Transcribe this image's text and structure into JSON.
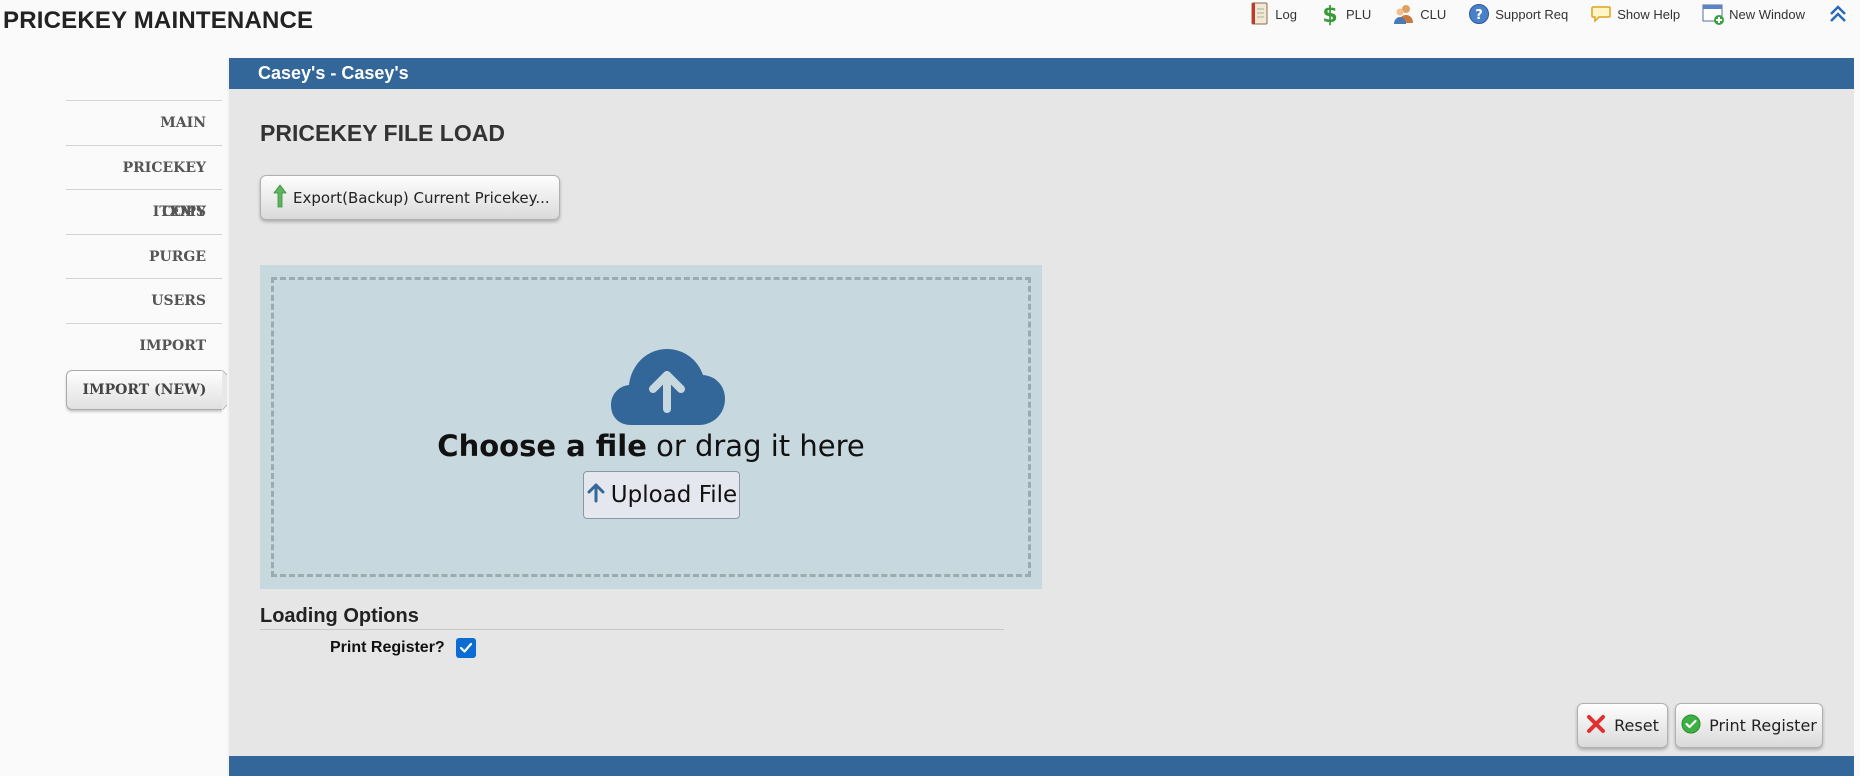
{
  "app": {
    "title": "PRICEKEY MAINTENANCE"
  },
  "toolbar": {
    "items": [
      {
        "label": "Log",
        "icon": "log-icon"
      },
      {
        "label": "PLU",
        "icon": "dollar-icon"
      },
      {
        "label": "CLU",
        "icon": "users-icon"
      },
      {
        "label": "Support Req",
        "icon": "help-icon"
      },
      {
        "label": "Show Help",
        "icon": "speech-bubble-icon"
      },
      {
        "label": "New Window",
        "icon": "new-window-icon"
      }
    ],
    "collapse_icon": "chevron-up-icon"
  },
  "sidebar": {
    "items": [
      {
        "label": "MAIN"
      },
      {
        "label": "PRICEKEY ITEMS"
      },
      {
        "label": "COPY"
      },
      {
        "label": "PURGE"
      },
      {
        "label": "USERS"
      },
      {
        "label": "IMPORT"
      },
      {
        "label": "IMPORT (NEW)",
        "active": true
      }
    ]
  },
  "main": {
    "header": "Casey's - Casey's",
    "page_title": "PRICEKEY FILE LOAD",
    "export_button": "Export(Backup) Current Pricekey...",
    "dropzone": {
      "choose_bold": "Choose a file",
      "choose_rest": " or drag it here",
      "upload_button": "Upload File"
    },
    "loading_options": {
      "title": "Loading Options",
      "print_register_label": "Print Register?",
      "print_register_checked": true
    },
    "reset_button": "Reset",
    "print_register_button": "Print Register"
  },
  "colors": {
    "header_blue": "#336699",
    "dropzone_bg": "#c8d8df",
    "cloud_blue": "#336699",
    "checkbox_blue": "#0a6cd4"
  }
}
